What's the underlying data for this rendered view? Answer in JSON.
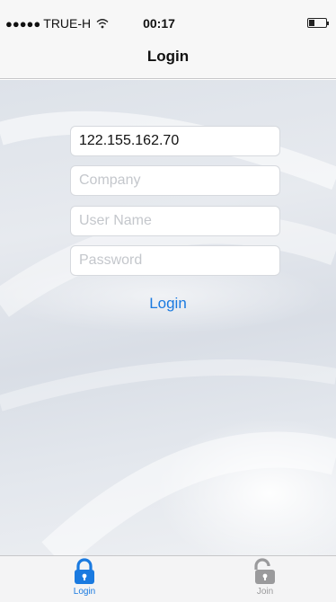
{
  "status_bar": {
    "signal": "●●●●●",
    "carrier": "TRUE-H",
    "time": "00:17"
  },
  "nav": {
    "title": "Login"
  },
  "form": {
    "server": {
      "value": "122.155.162.70",
      "placeholder": ""
    },
    "company": {
      "value": "",
      "placeholder": "Company"
    },
    "username": {
      "value": "",
      "placeholder": "User Name"
    },
    "password": {
      "value": "",
      "placeholder": "Password"
    },
    "login_label": "Login"
  },
  "tabs": [
    {
      "label": "Login",
      "icon": "lock-closed-icon",
      "active": true,
      "color": "#1a7ae0"
    },
    {
      "label": "Join",
      "icon": "lock-open-icon",
      "active": false,
      "color": "#9a9a9c"
    }
  ]
}
